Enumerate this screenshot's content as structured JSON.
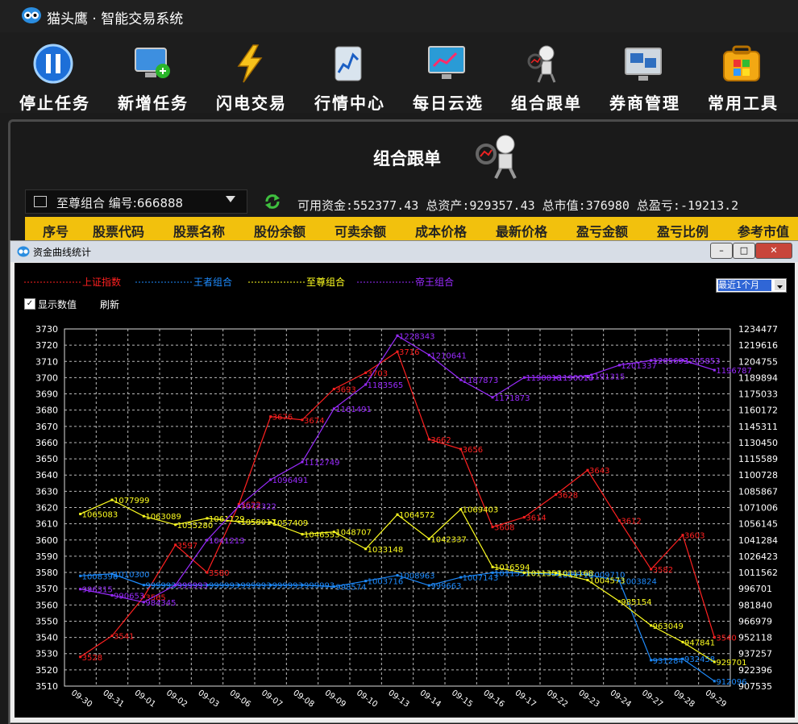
{
  "app": {
    "title": "猫头鹰 · 智能交易系统"
  },
  "toolbar": {
    "items": [
      {
        "label": "停止任务",
        "icon": "pause-icon"
      },
      {
        "label": "新增任务",
        "icon": "add-monitor-icon"
      },
      {
        "label": "闪电交易",
        "icon": "lightning-icon"
      },
      {
        "label": "行情中心",
        "icon": "market-chart-icon"
      },
      {
        "label": "每日云选",
        "icon": "cloud-pick-icon"
      },
      {
        "label": "组合跟单",
        "icon": "follow-figure-icon"
      },
      {
        "label": "券商管理",
        "icon": "broker-screen-icon"
      },
      {
        "label": "常用工具",
        "icon": "toolbox-icon"
      }
    ]
  },
  "panel": {
    "title": "组合跟单",
    "portfolio_select": "至尊组合 编号:666888",
    "stats": "可用资金:552377.43 总资产:929357.43 总市值:376980 总盈亏:-19213.2",
    "columns": [
      "序号",
      "股票代码",
      "股票名称",
      "股份余额",
      "可卖余额",
      "成本价格",
      "最新价格",
      "盈亏金额",
      "盈亏比例",
      "参考市值"
    ]
  },
  "dialog": {
    "title": "资金曲线统计",
    "range_select": "最近1个月",
    "show_values_label": "显示数值",
    "refresh_label": "刷新",
    "btn_min": "–",
    "btn_max": "□",
    "btn_close": "✕"
  },
  "chart_data": {
    "type": "line",
    "x": [
      "09-30",
      "08-31",
      "09-01",
      "09-02",
      "09-03",
      "09-06",
      "09-07",
      "09-08",
      "09-09",
      "09-10",
      "09-13",
      "09-14",
      "09-15",
      "09-16",
      "09-17",
      "09-22",
      "09-23",
      "09-24",
      "09-27",
      "09-28",
      "09-29"
    ],
    "y_left_ticks": [
      "3730",
      "3720",
      "3710",
      "3700",
      "3690",
      "3680",
      "3670",
      "3660",
      "3650",
      "3640",
      "3630",
      "3620",
      "3610",
      "3600",
      "3590",
      "3580",
      "3570",
      "3560",
      "3550",
      "3540",
      "3530",
      "3520",
      "3510"
    ],
    "y_right_ticks": [
      "1234477",
      "1219616",
      "1204755",
      "1189894",
      "1175033",
      "1160172",
      "1145311",
      "1130450",
      "1115589",
      "1100728",
      "1085867",
      "1071006",
      "1056145",
      "1041284",
      "1026423",
      "1011562",
      "996701",
      "981840",
      "966979",
      "952118",
      "937257",
      "922396",
      "907535"
    ],
    "ylim_left": [
      3510,
      3730
    ],
    "ylim_right": [
      907535,
      1234477
    ],
    "grid": true,
    "legend_position": "top-left",
    "series": [
      {
        "name": "上证指数",
        "axis": "left",
        "color": "#ff2020",
        "values": [
          3528,
          3541,
          3565,
          3597,
          3580,
          3622,
          3676,
          3674,
          3693,
          3703,
          3716,
          3662,
          3656,
          3608,
          3614,
          3628,
          3643,
          3612,
          3582,
          3603,
          3540
        ],
        "labels": [
          "3528",
          "3541",
          "3565",
          "3597",
          "3580",
          "3622",
          "3676",
          "3674",
          "3693",
          "3703",
          "3716",
          "3662",
          "3656",
          "3608",
          "3614",
          "3628",
          "3643",
          "3612",
          "3582",
          "3603",
          "3540"
        ]
      },
      {
        "name": "王者组合",
        "axis": "right",
        "color": "#1e8cff",
        "values": [
          1008396,
          1010300,
          999993,
          999993,
          999993,
          999993,
          999993,
          999993,
          998574,
          1003716,
          1008963,
          999663,
          1007143,
          1011351,
          1011168,
          1009710,
          1009710,
          1003824,
          931284,
          932458,
          912096
        ],
        "labels": [
          "1008396",
          "1010300",
          "999993",
          "999993",
          "999993",
          "999993",
          "999993",
          "999993",
          "998574",
          "1003716",
          "1008963",
          "999663",
          "1007143",
          "1011351",
          "1011168",
          "1009710",
          "1009710",
          "1003824",
          "931284",
          "932458",
          "912096"
        ]
      },
      {
        "name": "至尊组合",
        "axis": "right",
        "color": "#ffff20",
        "values": [
          1065083,
          1077999,
          1063089,
          1055280,
          1061129,
          1058017,
          1057409,
          1046553,
          1048707,
          1033148,
          1064572,
          1042337,
          1069403,
          1016594,
          1011351,
          1011168,
          1004573,
          985154,
          963049,
          947841,
          929701
        ],
        "labels": [
          "1065083",
          "1077999",
          "1063089",
          "1055280",
          "1061129",
          "1058017",
          "1057409",
          "1046553",
          "1048707",
          "1033148",
          "1064572",
          "1042337",
          "1069403",
          "1016594",
          "1011351",
          "1011168",
          "1004573",
          "985154",
          "963049",
          "947841",
          "929701"
        ]
      },
      {
        "name": "帝王组合",
        "axis": "right",
        "color": "#9a2bff",
        "values": [
          996315,
          990653,
          984345,
          999993,
          1041213,
          1072322,
          1096491,
          1112749,
          1161491,
          1183565,
          1228343,
          1210641,
          1187873,
          1171873,
          1190018,
          1190018,
          1191315,
          1201337,
          1205693,
          1205853,
          1196787
        ],
        "labels": [
          "996315",
          "990653",
          "984345",
          "999993",
          "1041213",
          "1072322",
          "1096491",
          "1112749",
          "1161491",
          "1183565",
          "1228343",
          "1210641",
          "1187873",
          "1171873",
          "1190018",
          "1190018",
          "1191315",
          "1201337",
          "1205693",
          "1205853",
          "1196787"
        ]
      }
    ]
  }
}
